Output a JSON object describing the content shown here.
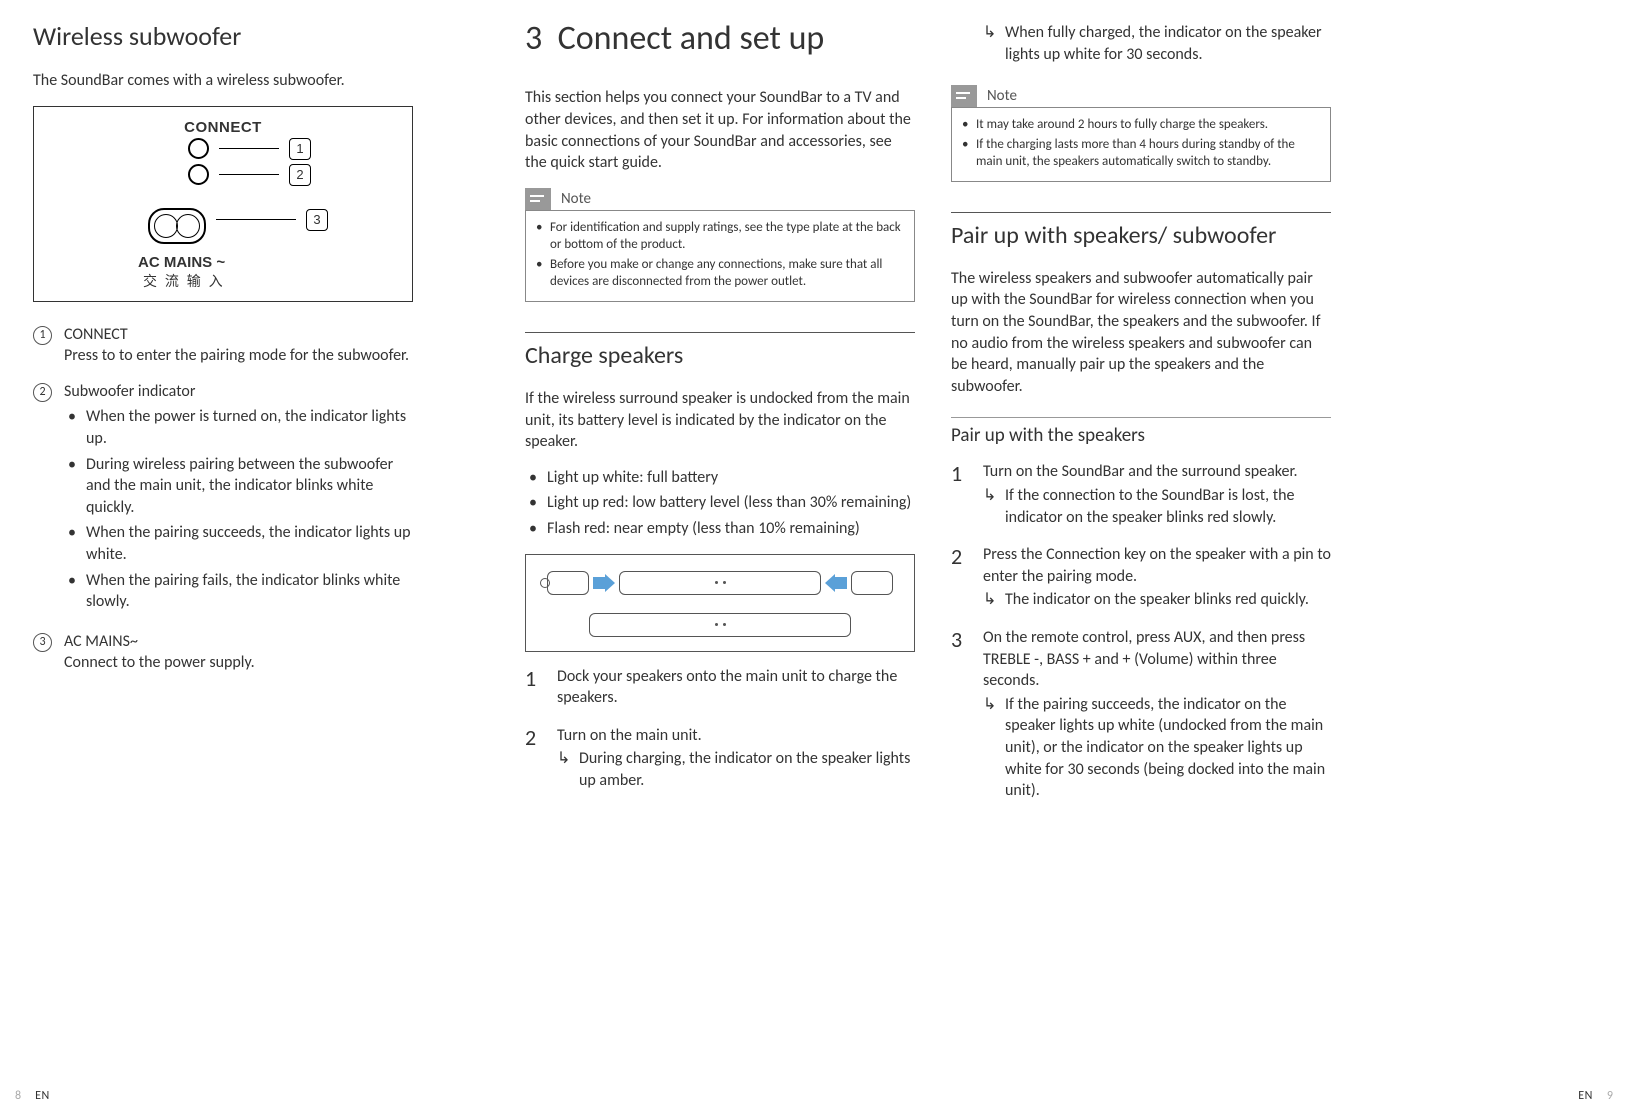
{
  "col1": {
    "heading": "Wireless subwoofer",
    "intro": "The SoundBar comes with a wireless subwoofer.",
    "diagram": {
      "connect": "CONNECT",
      "c1": "1",
      "c2": "2",
      "c3": "3",
      "ac": "AC MAINS ~",
      "cjk": "交 流 输 入"
    },
    "items": [
      {
        "num": "1",
        "title": "CONNECT",
        "desc": "Press to to enter the pairing mode for the subwoofer."
      },
      {
        "num": "2",
        "title": "Subwoofer indicator",
        "bullets": [
          "When the power is turned on, the indicator lights up.",
          "During wireless pairing between the subwoofer and the main unit, the indicator blinks white quickly.",
          "When the pairing succeeds, the indicator lights up white.",
          "When the pairing fails, the indicator blinks white slowly."
        ]
      },
      {
        "num": "3",
        "title": "AC MAINS~",
        "desc": "Connect to the power supply."
      }
    ]
  },
  "col2": {
    "chapnum": "3",
    "heading": "Connect and set up",
    "intro": "This section helps you connect your SoundBar to a TV and other devices, and then set it up. For information about the basic connections of your SoundBar and accessories, see the quick start guide.",
    "note_label": "Note",
    "note_items": [
      "For identification and supply ratings, see the type plate at the back or bottom of the product.",
      "Before you make or change any connections, make sure that all devices are disconnected from the power outlet."
    ],
    "sub_heading": "Charge speakers",
    "sub_intro": "If the wireless surround speaker is undocked from the main unit, its battery level is indicated by the indicator on the speaker.",
    "sub_bullets": [
      "Light up white: full battery",
      "Light up red: low battery level (less than 30% remaining)",
      "Flash red: near empty (less than 10% remaining)"
    ],
    "steps": [
      {
        "text": "Dock your speakers onto the main unit to charge the speakers."
      },
      {
        "text": "Turn on the main unit.",
        "result": "During charging, the indicator on the speaker lights up amber."
      }
    ]
  },
  "col3": {
    "top_result": "When fully charged, the indicator on the speaker lights up white for 30 seconds.",
    "note_label": "Note",
    "note_items": [
      "It may take around 2 hours to fully charge the speakers.",
      "If the charging lasts more than 4 hours during standby of the main unit, the speakers automatically switch to standby."
    ],
    "pair_heading": "Pair up with speakers/ subwoofer",
    "pair_intro": "The wireless speakers and subwoofer automatically pair up with the SoundBar for wireless connection when you turn on the SoundBar, the speakers and the subwoofer. If no audio from the wireless speakers and subwoofer can be heard, manually pair up the speakers and the subwoofer.",
    "pair_sub": "Pair up with the speakers",
    "steps": [
      {
        "text": "Turn on the SoundBar and the surround speaker.",
        "result": "If the connection to the SoundBar is lost, the indicator on the speaker blinks red slowly."
      },
      {
        "pre": "Press the ",
        "b1": "Connection key",
        "post": " on the speaker with a pin to enter the pairing mode.",
        "result": "The indicator on the speaker blinks red quickly."
      },
      {
        "pre": "On the remote control, press ",
        "b1": "AUX",
        "mid1": ", and then press ",
        "b2": "TREBLE -",
        "mid2": ", ",
        "b3": "BASS +",
        "mid3": " and ",
        "b4": "+",
        "mid4": " (",
        "b5": "Volume",
        "post": ") within three seconds.",
        "result": "If the pairing succeeds, the indicator on the speaker lights up white (undocked from the main unit), or the indicator on the speaker lights up white for 30 seconds (being docked into the main unit)."
      }
    ]
  },
  "footer": {
    "left_page": "8",
    "left_lang": "EN",
    "right_lang": "EN",
    "right_page": "9"
  }
}
